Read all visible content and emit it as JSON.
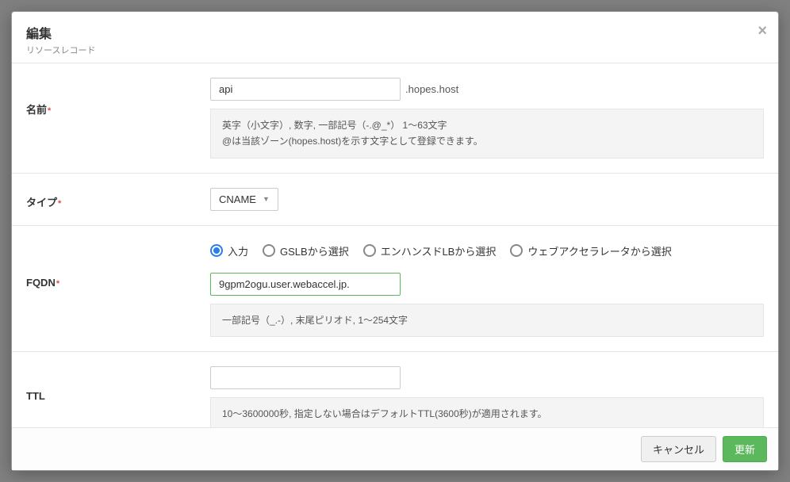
{
  "header": {
    "title": "編集",
    "subtitle": "リソースレコード",
    "close": "×"
  },
  "fields": {
    "name": {
      "label": "名前",
      "value": "api",
      "suffix": ".hopes.host",
      "hint_line1": "英字（小文字）, 数字, 一部記号（-.@_*）  1〜63文字",
      "hint_line2": "@は当該ゾーン(hopes.host)を示す文字として登録できます。"
    },
    "type": {
      "label": "タイプ",
      "value": "CNAME"
    },
    "fqdn": {
      "label": "FQDN",
      "radios": {
        "input": "入力",
        "gslb": "GSLBから選択",
        "elb": "エンハンスドLBから選択",
        "webaccel": "ウェブアクセラレータから選択"
      },
      "value": "9gpm2ogu.user.webaccel.jp.",
      "hint": "一部記号（_.-）, 末尾ピリオド, 1〜254文字"
    },
    "ttl": {
      "label": "TTL",
      "value": "",
      "hint": "10〜3600000秒, 指定しない場合はデフォルトTTL(3600秒)が適用されます。"
    }
  },
  "footer": {
    "cancel": "キャンセル",
    "submit": "更新"
  }
}
